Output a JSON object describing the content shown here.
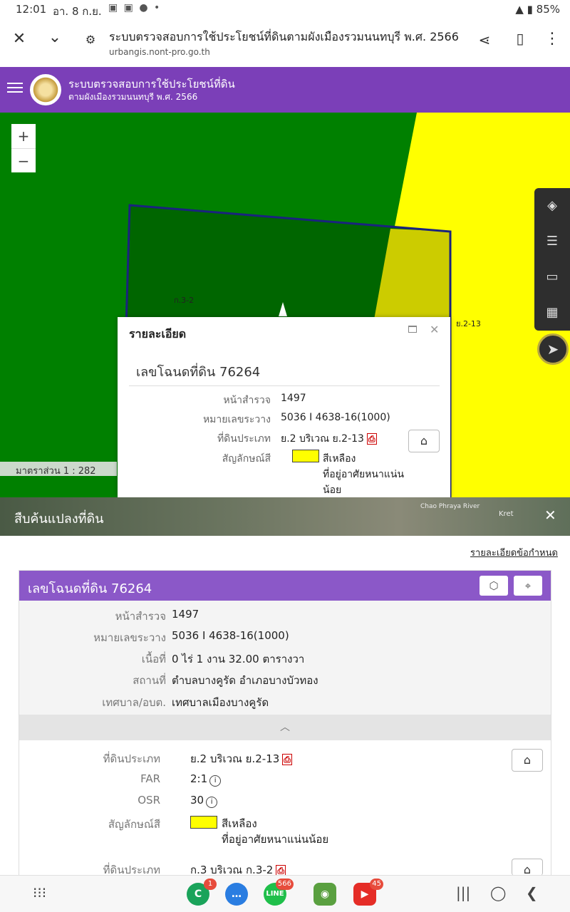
{
  "status": {
    "time": "12:01",
    "date": "อา. 8 ก.ย.",
    "battery": "85%"
  },
  "browser": {
    "title": "ระบบตรวจสอบการใช้ประโยชน์ที่ดินตามผังเมืองรวมนนทบุรี พ.ศ. 2566",
    "url": "urbangis.nont-pro.go.th"
  },
  "app_header": {
    "title_line1": "ระบบตรวจสอบการใช้ประโยชน์ที่ดิน",
    "title_line2": "ตามผังเมืองรวมนนทบุรี พ.ศ. 2566"
  },
  "map": {
    "zoom_in": "+",
    "zoom_out": "−",
    "zone_label_left": "ก.3-2",
    "zone_label_right": "ย.2-13",
    "scale_label": "มาตราส่วน 1 : 282",
    "colors": {
      "green_zone": "#008000",
      "yellow_zone": "#ffff00",
      "parcel_border": "#1a237e"
    }
  },
  "popup": {
    "title": "รายละเอียด",
    "lot": "เลขโฉนดที่ดิน 76264",
    "rows": [
      {
        "label": "หน้าสำรวจ",
        "value": "1497"
      },
      {
        "label": "หมายเลขระวาง",
        "value": "5036 I 4638-16(1000)"
      },
      {
        "label": "ที่ดินประเภท",
        "value": "ย.2 บริเวณ ย.2-13"
      },
      {
        "label": "สัญลักษณ์สี",
        "value": "สีเหลือง"
      }
    ],
    "color_desc_line2": "ที่อยู่อาศัยหนาแน่น",
    "color_desc_line3": "น้อย"
  },
  "search": {
    "title": "สืบค้นแปลงที่ดิน",
    "close": "✕",
    "map_label1": "Chao Phraya River",
    "map_label2": "Kret"
  },
  "details_link": "รายละเอียดข้อกำหนด",
  "card": {
    "title": "เลขโฉนดที่ดิน 76264",
    "rows": [
      {
        "label": "หน้าสำรวจ",
        "value": "1497"
      },
      {
        "label": "หมายเลขระวาง",
        "value": "5036 I 4638-16(1000)"
      },
      {
        "label": "เนื้อที่",
        "value": "0 ไร่ 1 งาน 32.00 ตารางวา"
      },
      {
        "label": "สถานที่",
        "value": "ตำบลบางคูรัด อำเภอบางบัวทอง"
      },
      {
        "label": "เทศบาล/อบต.",
        "value": "เทศบาลเมืองบางคูรัด"
      }
    ],
    "zone1": {
      "type_label": "ที่ดินประเภท",
      "type_value": "ย.2 บริเวณ ย.2-13",
      "far_label": "FAR",
      "far_value": "2:1",
      "osr_label": "OSR",
      "osr_value": "30",
      "color_label": "สัญลักษณ์สี",
      "color_value": "สีเหลือง",
      "color_desc": "ที่อยู่อาศัยหนาแน่นน้อย"
    },
    "zone2": {
      "type_label": "ที่ดินประเภท",
      "type_value": "ก.3 บริเวณ ก.3-2"
    }
  },
  "navbar": {
    "badge_phone": "1",
    "badge_line": "566",
    "badge_youtube": "45"
  }
}
